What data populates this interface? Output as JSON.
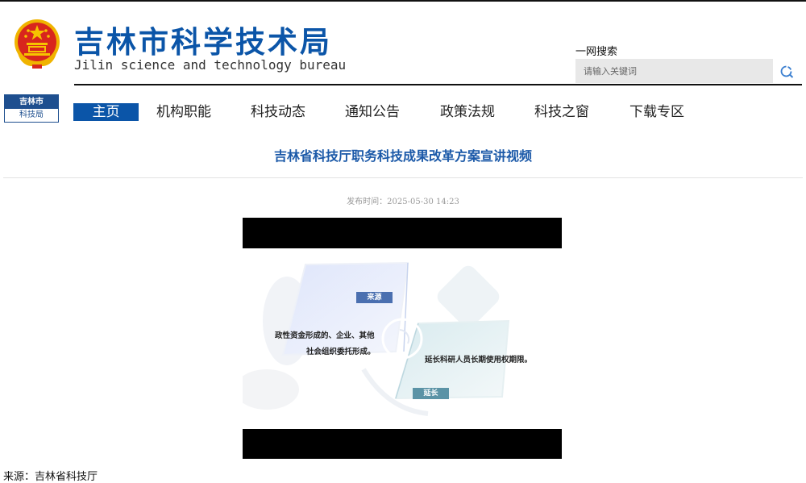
{
  "header": {
    "title": "吉林市科学技术局",
    "subtitle": "Jilin science and technology bureau",
    "emblem": "national-emblem-icon"
  },
  "search": {
    "label": "一网搜索",
    "placeholder": "请输入关键词",
    "icon": "search-icon"
  },
  "mini_logo": {
    "top": "吉林市",
    "bottom": "科技局"
  },
  "nav": {
    "items": [
      "主页",
      "机构职能",
      "科技动态",
      "通知公告",
      "政策法规",
      "科技之窗",
      "下载专区"
    ],
    "active": "主页"
  },
  "article": {
    "title": "吉林省科技厅职务科技成果改革方案宣讲视频",
    "publish_label": "发布时间：",
    "publish_date": "2025-05-30 14:23",
    "source": "来源：吉林省科技厅"
  },
  "video": {
    "tag_source": "来源",
    "text_left_line1": "政性资金形成的、企业、其他",
    "text_left_line2": "社会组织委托形成。",
    "text_right": "延长科研人员长期使用权期限。",
    "tag_extend": "延长"
  },
  "colors": {
    "brand_blue": "#0b55a8",
    "nav_active_bg": "#0b55a8",
    "title_blue": "#1b59a8",
    "tag_blue": "#4a6fb0",
    "tag_teal": "#5b93a6"
  }
}
